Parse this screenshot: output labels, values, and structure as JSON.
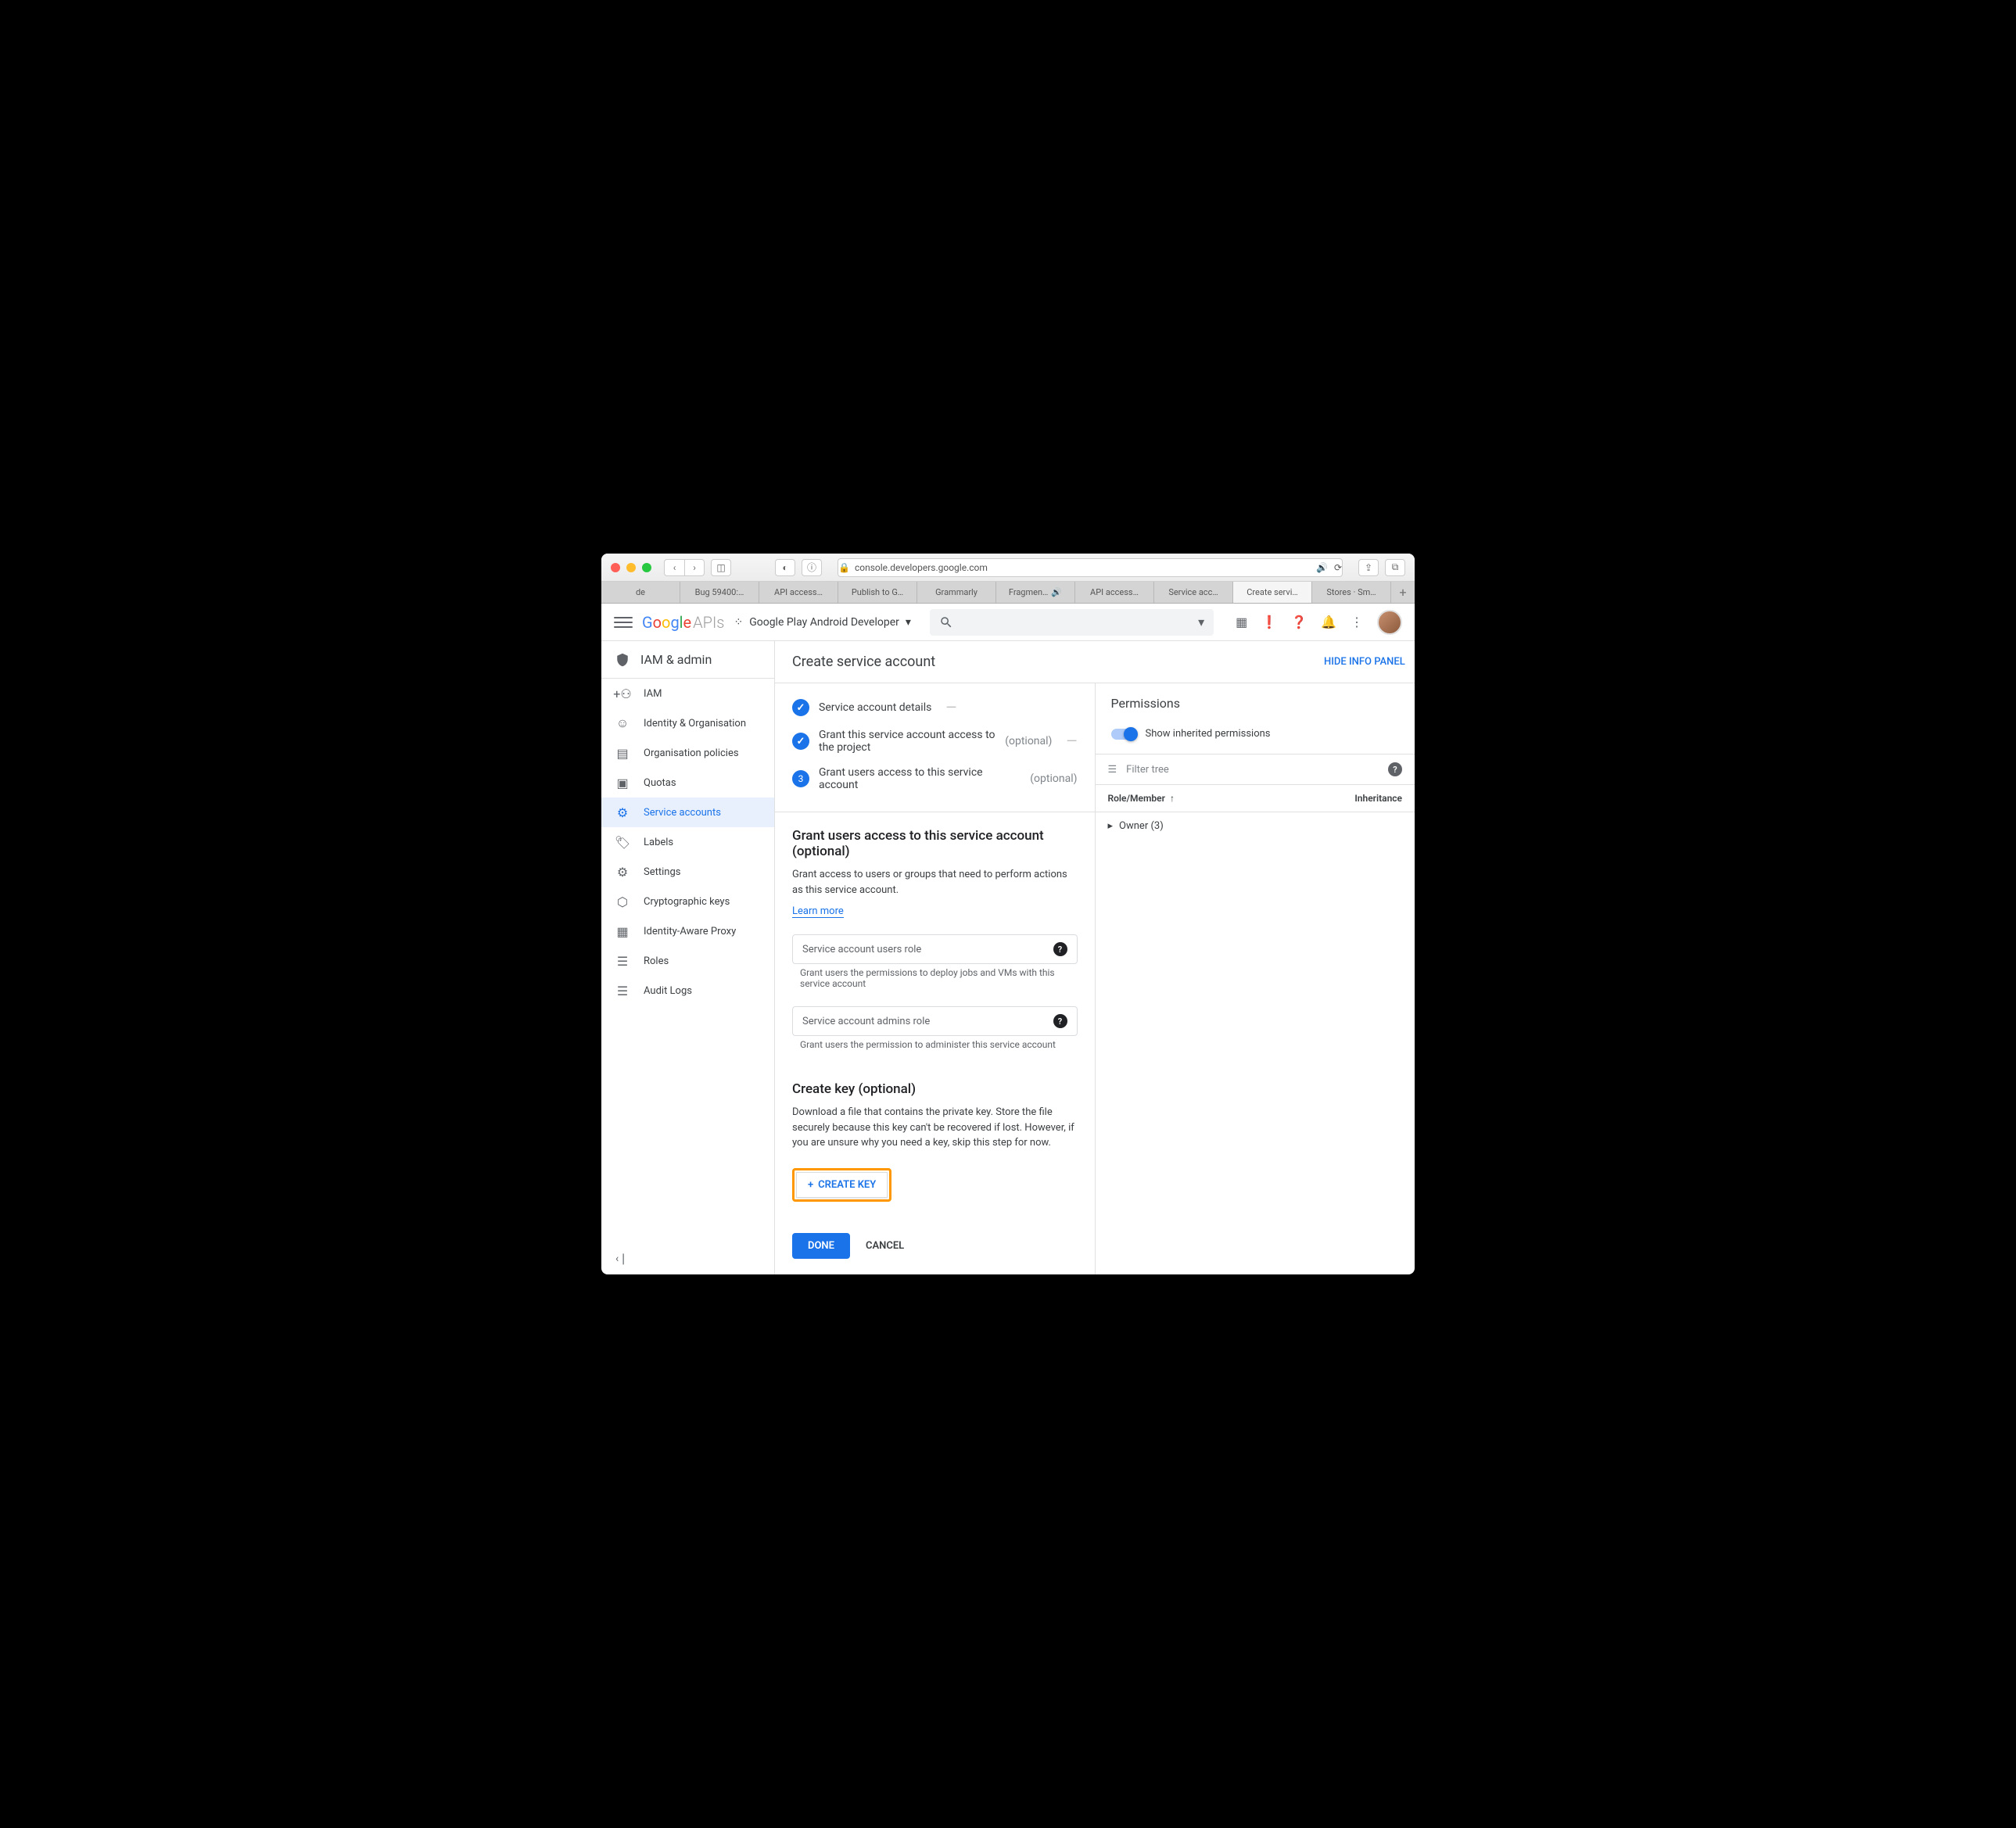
{
  "browser": {
    "url": "console.developers.google.com",
    "tabs": [
      "de",
      "Bug 59400:…",
      "API access…",
      "Publish to G…",
      "Grammarly",
      "Fragmen…",
      "API access…",
      "Service acc…",
      "Create servi…",
      "Stores · Sm…"
    ]
  },
  "header": {
    "logo_text": "Google",
    "logo_suffix": "APIs",
    "project": "Google Play Android Developer"
  },
  "sidebar": {
    "title": "IAM & admin",
    "items": [
      {
        "label": "IAM"
      },
      {
        "label": "Identity & Organisation"
      },
      {
        "label": "Organisation policies"
      },
      {
        "label": "Quotas"
      },
      {
        "label": "Service accounts"
      },
      {
        "label": "Labels"
      },
      {
        "label": "Settings"
      },
      {
        "label": "Cryptographic keys"
      },
      {
        "label": "Identity-Aware Proxy"
      },
      {
        "label": "Roles"
      },
      {
        "label": "Audit Logs"
      }
    ]
  },
  "page": {
    "title": "Create service account",
    "info_link": "HIDE INFO PANEL",
    "steps": {
      "s1": "Service account details",
      "s2": "Grant this service account access to the project",
      "s3": "Grant users access to this service account",
      "optional": "(optional)"
    },
    "grant_section": {
      "title": "Grant users access to this service account (optional)",
      "desc": "Grant access to users or groups that need to perform actions as this service account.",
      "learn": "Learn more",
      "field1_label": "Service account users role",
      "field1_hint": "Grant users the permissions to deploy jobs and VMs with this service account",
      "field2_label": "Service account admins role",
      "field2_hint": "Grant users the permission to administer this service account"
    },
    "key_section": {
      "title": "Create key (optional)",
      "desc": "Download a file that contains the private key. Store the file securely because this key can't be recovered if lost. However, if you are unsure why you need a key, skip this step for now.",
      "button": "CREATE KEY"
    },
    "actions": {
      "done": "DONE",
      "cancel": "CANCEL"
    }
  },
  "panel": {
    "title": "Permissions",
    "toggle_label": "Show inherited permissions",
    "filter_placeholder": "Filter tree",
    "col1": "Role/Member",
    "col2": "Inheritance",
    "row1": "Owner (3)"
  }
}
